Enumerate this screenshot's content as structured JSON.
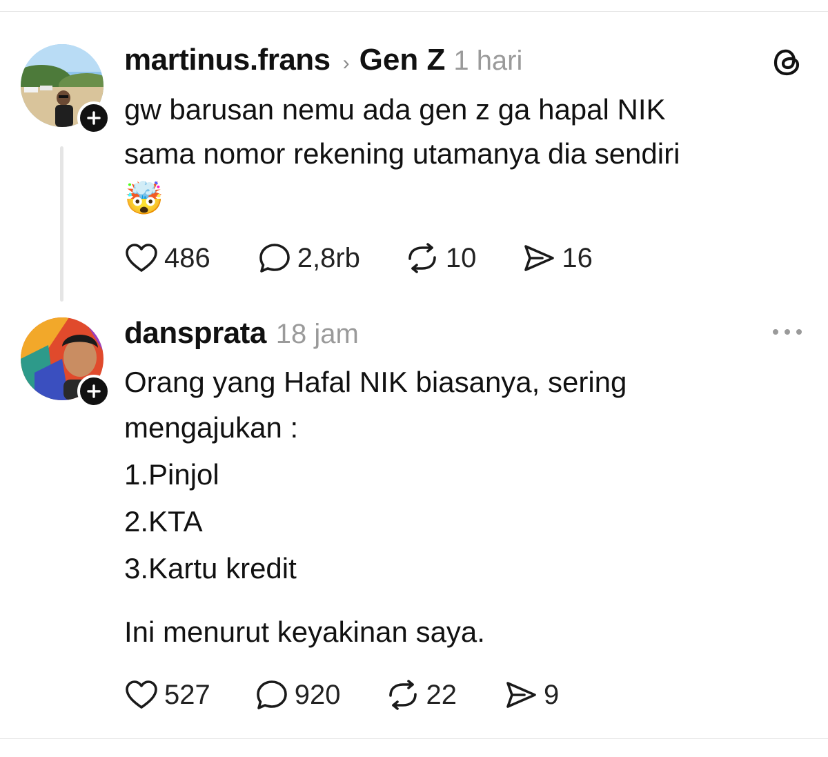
{
  "posts": [
    {
      "username": "martinus.frans",
      "topic": "Gen Z",
      "time": "1 hari",
      "text_lines": [
        "gw barusan nemu ada gen z ga hapal NIK",
        "sama nomor rekening utamanya dia sendiri"
      ],
      "emoji": "🤯",
      "stats": {
        "likes": "486",
        "replies": "2,8rb",
        "reposts": "10",
        "shares": "16"
      },
      "corner_icon": "threads-logo-icon"
    },
    {
      "username": "dansprata",
      "time": "18 jam",
      "text_lines": [
        "Orang yang Hafal NIK biasanya, sering",
        "mengajukan :"
      ],
      "list_items": [
        "1.Pinjol",
        "2.KTA",
        "3.Kartu kredit"
      ],
      "closing": "Ini menurut keyakinan saya.",
      "stats": {
        "likes": "527",
        "replies": "920",
        "reposts": "22",
        "shares": "9"
      },
      "corner_icon": "more-options-icon"
    }
  ],
  "icons": [
    "heart-icon",
    "comment-icon",
    "repost-icon",
    "share-icon",
    "plus-icon",
    "chevron-right-icon"
  ]
}
